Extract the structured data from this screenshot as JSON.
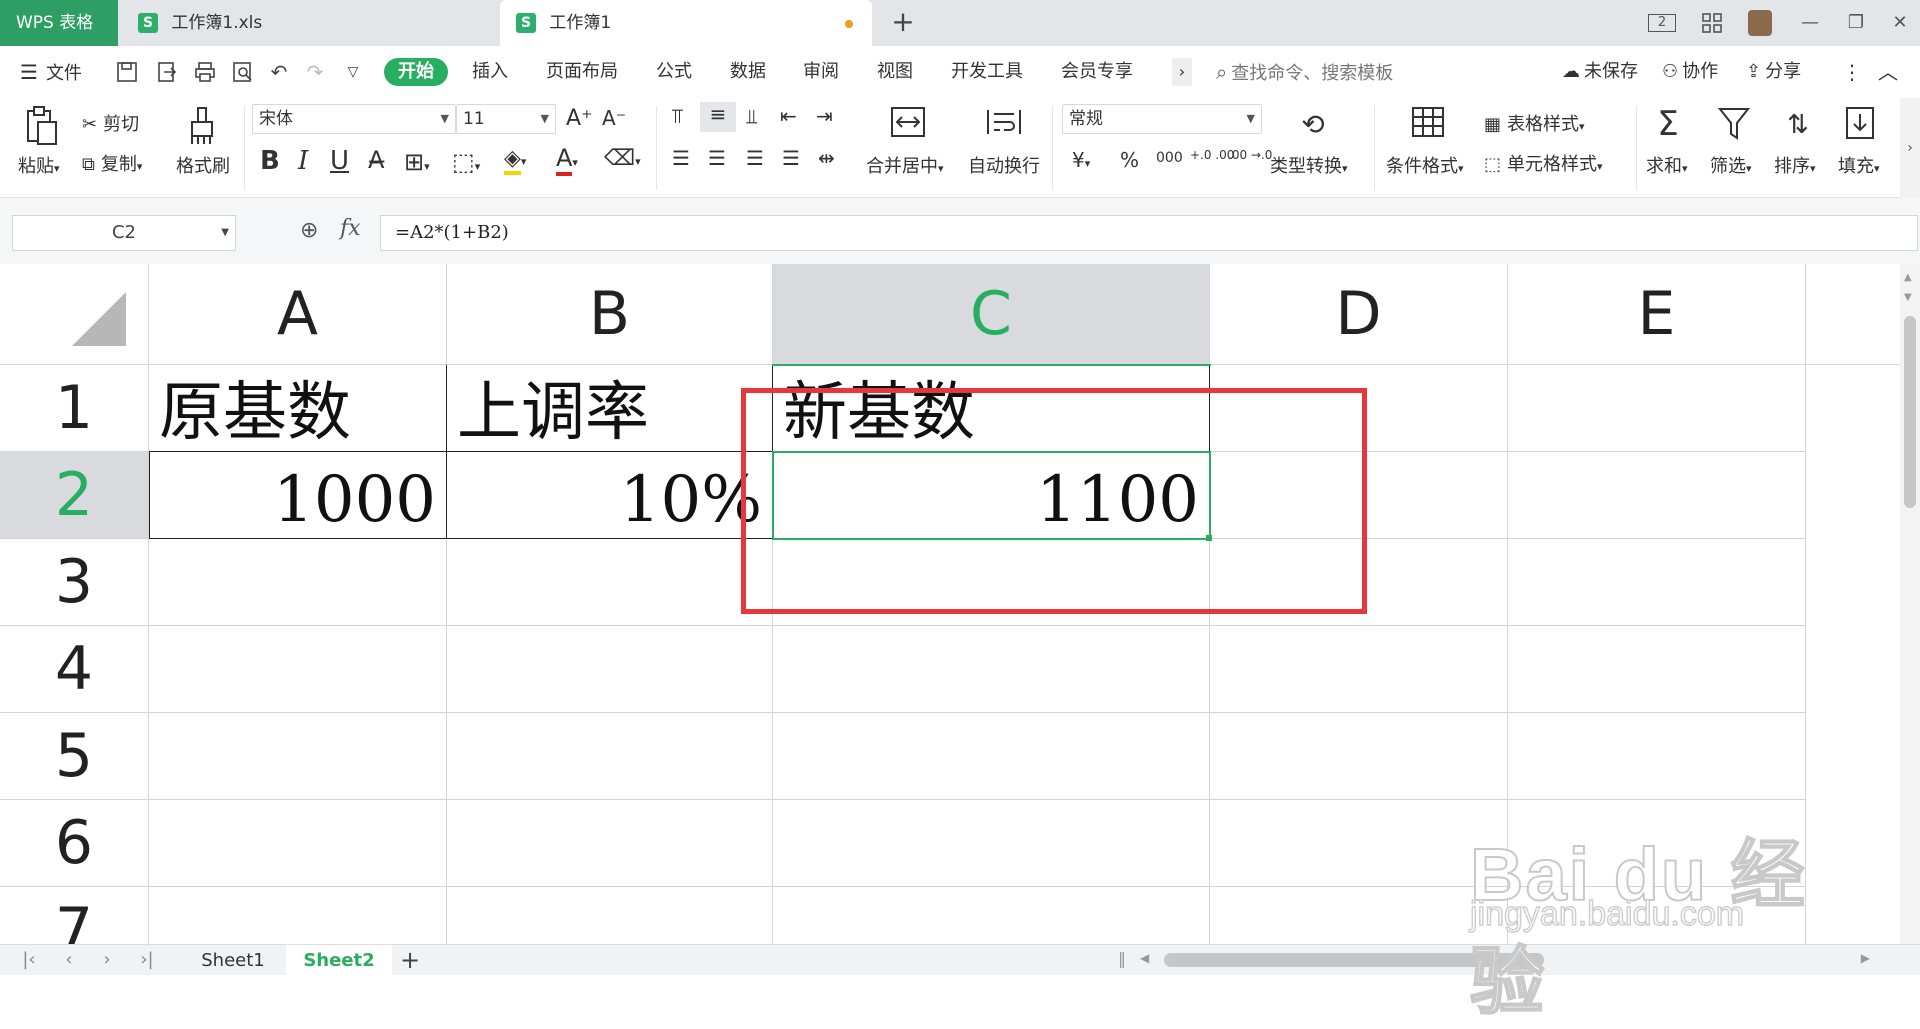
{
  "titlebar": {
    "app_tab": "WPS 表格",
    "tabs": [
      {
        "label": "工作簿1.xls",
        "icon": "S"
      },
      {
        "label": "工作簿1",
        "icon": "S"
      }
    ],
    "new_tab": "+",
    "page_badge": "2"
  },
  "menubar": {
    "file": "文件",
    "items": [
      "开始",
      "插入",
      "页面布局",
      "公式",
      "数据",
      "审阅",
      "视图",
      "开发工具",
      "会员专享"
    ],
    "more": "›",
    "search_placeholder": "查找命令、搜索模板",
    "unsaved": "未保存",
    "collab": "协作",
    "share": "分享"
  },
  "ribbon": {
    "paste": "粘贴",
    "cut": "剪切",
    "copy": "复制",
    "format_painter": "格式刷",
    "font_name": "宋体",
    "font_size": "11",
    "merge_center": "合并居中",
    "wrap_text": "自动换行",
    "number_format": "常规",
    "type_convert": "类型转换",
    "conditional_format": "条件格式",
    "table_style": "表格样式",
    "cell_style": "单元格样式",
    "sum": "求和",
    "filter": "筛选",
    "sort": "排序",
    "fill": "填充",
    "currency_symbol": "¥",
    "percent_symbol": "%",
    "thousands": "000",
    "inc_decimal": "+.0 .00",
    "dec_decimal": ".00 →.0"
  },
  "formula_bar": {
    "cell_ref": "C2",
    "fx": "fx",
    "formula": "=A2*(1+B2)"
  },
  "sheet": {
    "columns": [
      "A",
      "B",
      "C",
      "D",
      "E"
    ],
    "rows": [
      "1",
      "2",
      "3",
      "4",
      "5",
      "6",
      "7"
    ],
    "cells": {
      "A1": "原基数",
      "B1": "上调率",
      "C1": "新基数",
      "A2": "1000",
      "B2": "10%",
      "C2": "1100"
    },
    "selected_cell": "C2"
  },
  "sheet_tabs": [
    "Sheet1",
    "Sheet2"
  ],
  "active_sheet": "Sheet2",
  "watermark": {
    "main": "Bai du 经验",
    "sub": "jingyan.baidu.com"
  },
  "colors": {
    "accent": "#27ae60",
    "app_tab": "#2d9f64",
    "highlight_box": "#e8373a"
  }
}
